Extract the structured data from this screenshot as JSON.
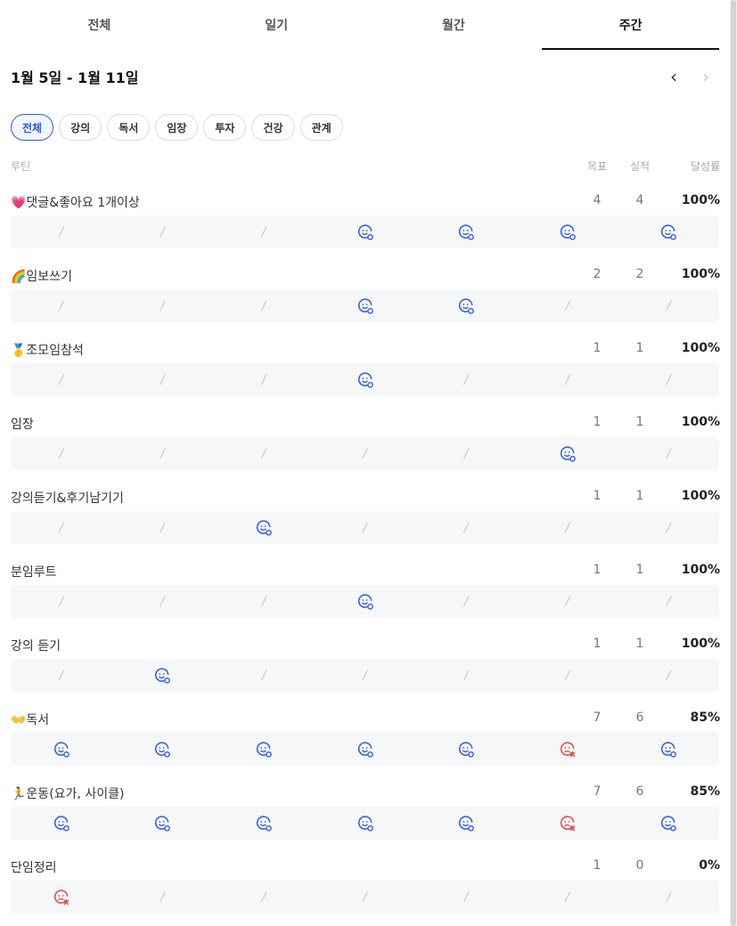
{
  "tabs": [
    {
      "label": "전체",
      "active": false
    },
    {
      "label": "일기",
      "active": false
    },
    {
      "label": "월간",
      "active": false
    },
    {
      "label": "주간",
      "active": true
    }
  ],
  "week": {
    "title": "1월 5일 - 1월 11일",
    "prev": "‹",
    "next": "›"
  },
  "chips": [
    {
      "label": "전체",
      "active": true
    },
    {
      "label": "강의",
      "active": false
    },
    {
      "label": "독서",
      "active": false
    },
    {
      "label": "임장",
      "active": false
    },
    {
      "label": "투자",
      "active": false
    },
    {
      "label": "건강",
      "active": false
    },
    {
      "label": "관계",
      "active": false
    }
  ],
  "columns": {
    "routine": "루틴",
    "goal": "목표",
    "done": "실적",
    "rate": "달성률"
  },
  "colors": {
    "accent": "#2d5bd6",
    "success_icon": "#3b63e0",
    "fail_icon": "#e0524f",
    "slash": "#c8c8c8"
  },
  "routines": [
    {
      "name": "💗댓글&좋아요 1개이상",
      "goal": "4",
      "done": "4",
      "rate": "100%",
      "days": [
        "none",
        "none",
        "none",
        "smile",
        "smile",
        "smile",
        "smile"
      ]
    },
    {
      "name": "🌈임보쓰기",
      "goal": "2",
      "done": "2",
      "rate": "100%",
      "days": [
        "none",
        "none",
        "none",
        "smile",
        "smile",
        "none",
        "none"
      ]
    },
    {
      "name": "🥇조모임참석",
      "goal": "1",
      "done": "1",
      "rate": "100%",
      "days": [
        "none",
        "none",
        "none",
        "smile",
        "none",
        "none",
        "none"
      ]
    },
    {
      "name": "임장",
      "goal": "1",
      "done": "1",
      "rate": "100%",
      "days": [
        "none",
        "none",
        "none",
        "none",
        "none",
        "smile",
        "none"
      ]
    },
    {
      "name": "강의듣기&후기남기기",
      "goal": "1",
      "done": "1",
      "rate": "100%",
      "days": [
        "none",
        "none",
        "smile",
        "none",
        "none",
        "none",
        "none"
      ]
    },
    {
      "name": "분임루트",
      "goal": "1",
      "done": "1",
      "rate": "100%",
      "days": [
        "none",
        "none",
        "none",
        "smile",
        "none",
        "none",
        "none"
      ]
    },
    {
      "name": "강의 듣기",
      "goal": "1",
      "done": "1",
      "rate": "100%",
      "days": [
        "none",
        "smile",
        "none",
        "none",
        "none",
        "none",
        "none"
      ]
    },
    {
      "name": "👐독서",
      "goal": "7",
      "done": "6",
      "rate": "85%",
      "days": [
        "smile",
        "smile",
        "smile",
        "smile",
        "smile",
        "fail",
        "smile"
      ]
    },
    {
      "name": "🏃운동(요가, 사이클)",
      "goal": "7",
      "done": "6",
      "rate": "85%",
      "days": [
        "smile",
        "smile",
        "smile",
        "smile",
        "smile",
        "fail",
        "smile"
      ]
    },
    {
      "name": "단임정리",
      "goal": "1",
      "done": "0",
      "rate": "0%",
      "days": [
        "fail",
        "none",
        "none",
        "none",
        "none",
        "none",
        "none"
      ]
    }
  ],
  "icons": {
    "smile": "smile-check-icon",
    "fail": "sad-x-icon",
    "none": "slash-mark"
  }
}
